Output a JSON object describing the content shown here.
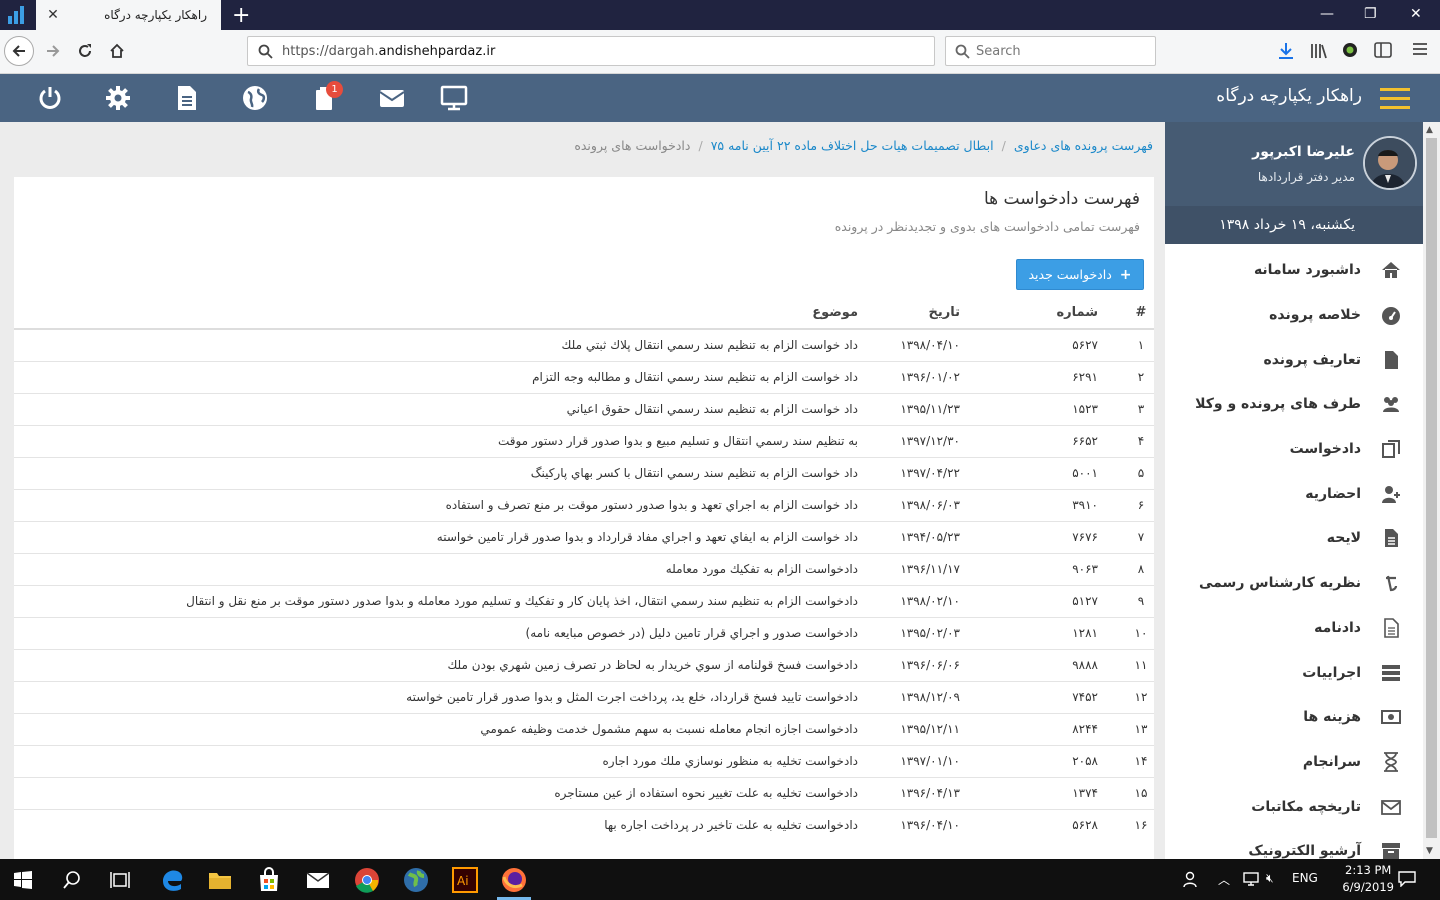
{
  "browser": {
    "tab_title": "راهکار یکپارچه درگاه",
    "url_prefix": "https://dargah.",
    "url_domain": "andishehpardaz.ir",
    "search_placeholder": "Search"
  },
  "header": {
    "brand": "راهکار یکپارچه درگاه",
    "notification_count": "1"
  },
  "user": {
    "name": "علیرضا اکبرپور",
    "role": "مدیر دفتر قراردادها",
    "date": "یکشنبه، ۱۹ خرداد ۱۳۹۸"
  },
  "sidebar": {
    "items": [
      {
        "label": "داشبورد سامانه",
        "icon": "home-icon"
      },
      {
        "label": "خلاصه پرونده",
        "icon": "dashboard-icon"
      },
      {
        "label": "تعاریف پرونده",
        "icon": "file-icon"
      },
      {
        "label": "طرف های پرونده و وکلا",
        "icon": "users-icon"
      },
      {
        "label": "دادخواست",
        "icon": "copy-icon"
      },
      {
        "label": "احضاریه",
        "icon": "user-plus-icon"
      },
      {
        "label": "لایحه",
        "icon": "document-icon"
      },
      {
        "label": "نظریه کارشناس رسمی",
        "icon": "currency-icon"
      },
      {
        "label": "دادنامه",
        "icon": "document-outline-icon"
      },
      {
        "label": "اجراییات",
        "icon": "server-icon"
      },
      {
        "label": "هزینه ها",
        "icon": "money-icon"
      },
      {
        "label": "سرانجام",
        "icon": "hourglass-icon"
      },
      {
        "label": "تاریخچه مکاتبات",
        "icon": "envelope-icon"
      },
      {
        "label": "آرشیو الکترونیک",
        "icon": "archive-icon"
      }
    ]
  },
  "breadcrumb": {
    "items": [
      "فهرست پرونده های دعاوی",
      "ابطال تصمیمات هیات حل اختلاف ماده ۲۲ آیین نامه ۷۵",
      "دادخواست های پرونده"
    ]
  },
  "card": {
    "title": "فهرست دادخواست ها",
    "subtitle": "فهرست تمامی دادخواست های بدوی و تجدیدنظر در پرونده",
    "new_button": "دادخواست جدید"
  },
  "table": {
    "headers": [
      "#",
      "شماره",
      "تاریخ",
      "موضوع"
    ],
    "rows": [
      [
        "۱",
        "۵۶۲۷",
        "۱۳۹۸/۰۴/۱۰",
        "داد خواست الزام به تنظیم سند رسمي انتقال پلاك ثبتي ملك"
      ],
      [
        "۲",
        "۶۲۹۱",
        "۱۳۹۶/۰۱/۰۲",
        "داد خواست الزام به تنظيم سند رسمي انتقال و مطالبه وجه التزام"
      ],
      [
        "۳",
        "۱۵۲۳",
        "۱۳۹۵/۱۱/۲۳",
        "داد خواست الزام به تنظيم سند رسمي انتقال حقوق اعياني"
      ],
      [
        "۴",
        "۶۶۵۲",
        "۱۳۹۷/۱۲/۳۰",
        "به تنظيم سند رسمي انتقال و تسليم مبيع و بدوا صدور قرار دستور موقت"
      ],
      [
        "۵",
        "۵۰۰۱",
        "۱۳۹۷/۰۴/۲۲",
        "داد خواست الزام به تنظيم سند رسمي انتقال با كسر بهاي پاركينگ"
      ],
      [
        "۶",
        "۳۹۱۰",
        "۱۳۹۸/۰۶/۰۳",
        "داد خواست الزام به اجراي تعهد و بدوا صدور دستور موقت بر منع تصرف و استفاده"
      ],
      [
        "۷",
        "۷۶۷۶",
        "۱۳۹۴/۰۵/۲۳",
        "داد خواست الزام به ايفاي تعهد و اجراي مفاد قرارداد و بدوا صدور قرار تامين خواسته"
      ],
      [
        "۸",
        "۹۰۶۳",
        "۱۳۹۶/۱۱/۱۷",
        "دادخواست الزام به تفكيك مورد معامله"
      ],
      [
        "۹",
        "۵۱۲۷",
        "۱۳۹۸/۰۲/۱۰",
        "دادخواست الزام به تنظيم سند رسمي انتقال، اخذ پايان كار و تفكيك و تسليم مورد معامله و بدوا صدور دستور موقت بر منع نقل و انتقال"
      ],
      [
        "۱۰",
        "۱۲۸۱",
        "۱۳۹۵/۰۲/۰۳",
        "دادخواست صدور و اجراي قرار تامين دليل (در خصوص مبايعه نامه)"
      ],
      [
        "۱۱",
        "۹۸۸۸",
        "۱۳۹۶/۰۶/۰۶",
        "دادخواست فسخ قولنامه از سوي خريدار به لحاظ در تصرف زمين شهري بودن ملك"
      ],
      [
        "۱۲",
        "۷۴۵۲",
        "۱۳۹۸/۱۲/۰۹",
        "دادخواست تاييد فسخ قرارداد، خلع يد، پرداخت اجرت المثل و بدوا صدور قرار تامين خواسته"
      ],
      [
        "۱۳",
        "۸۲۴۴",
        "۱۳۹۵/۱۲/۱۱",
        "دادخواست اجازه انجام معامله نسبت به سهم مشمول خدمت وظيفه عمومي"
      ],
      [
        "۱۴",
        "۲۰۵۸",
        "۱۳۹۷/۰۱/۱۰",
        "دادخواست تخليه به منظور نوسازي ملك مورد اجاره"
      ],
      [
        "۱۵",
        "۱۳۷۴",
        "۱۳۹۶/۰۴/۱۳",
        "دادخواست تخليه به علت تغيير نحوه استفاده از عين مستاجره"
      ],
      [
        "۱۶",
        "۵۶۲۸",
        "۱۳۹۶/۰۴/۱۰",
        "دادخواست تخليه به علت تاخير در پرداخت اجاره بها"
      ]
    ]
  },
  "taskbar": {
    "lang": "ENG",
    "time": "2:13 PM",
    "date": "6/9/2019"
  },
  "colors": {
    "header_bg": "#4a6482",
    "accent": "#3c9ee5",
    "hamburger": "#f2c12e",
    "badge": "#e74c3c"
  }
}
